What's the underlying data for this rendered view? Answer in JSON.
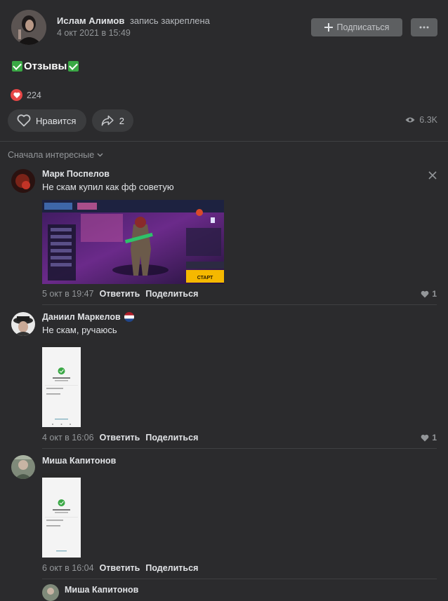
{
  "post": {
    "author": "Ислам Алимов",
    "pinned_note": "запись закреплена",
    "date": "4 окт 2021 в 15:49",
    "subscribe_label": "Подписаться",
    "text": "Отзывы",
    "reactions_count": "224",
    "like_label": "Нравится",
    "shares_count": "2",
    "views": "6.3K"
  },
  "sort_label": "Сначала интересные",
  "comments": [
    {
      "author": "Марк Поспелов",
      "text": "Не скам купил как фф советую",
      "date": "5 окт в 19:47",
      "reply": "Ответить",
      "share": "Поделиться",
      "likes": "1",
      "attachment_game_text": "СТАРТ"
    },
    {
      "author": "Даниил Маркелов",
      "text": "Не скам, ручаюсь",
      "date": "4 окт в 16:06",
      "reply": "Ответить",
      "share": "Поделиться",
      "likes": "1"
    },
    {
      "author": "Миша Капитонов",
      "text": "",
      "date": "6 окт в 16:04",
      "reply": "Ответить",
      "share": "Поделиться",
      "likes": ""
    },
    {
      "author": "Миша Капитонов"
    }
  ],
  "colors": {
    "background": "#2b2b2d",
    "accent_green": "#3aa845",
    "reaction_red": "#e64646"
  },
  "icons": [
    "plus-icon",
    "more-icon",
    "check-icon",
    "heart-icon",
    "share-icon",
    "eye-icon",
    "chevron-down-icon",
    "close-icon"
  ]
}
